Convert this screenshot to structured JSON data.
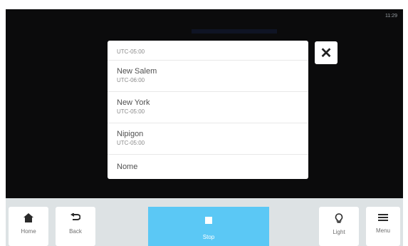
{
  "status": {
    "clock": "11:29"
  },
  "timezone_list": {
    "items": [
      {
        "name": "",
        "offset": "UTC-05:00"
      },
      {
        "name": "New Salem",
        "offset": "UTC-06:00"
      },
      {
        "name": "New York",
        "offset": "UTC-05:00"
      },
      {
        "name": "Nipigon",
        "offset": "UTC-05:00"
      },
      {
        "name": "Nome",
        "offset": ""
      }
    ]
  },
  "dialog": {
    "close_icon": "close-icon"
  },
  "toolbar": {
    "home_label": "Home",
    "back_label": "Back",
    "stop_label": "Stop",
    "light_label": "Light",
    "menu_label": "Menu"
  },
  "colors": {
    "screen_bg": "#0b0b0c",
    "toolbar_bg": "#dde2e4",
    "stop_accent": "#5bc8f5"
  }
}
